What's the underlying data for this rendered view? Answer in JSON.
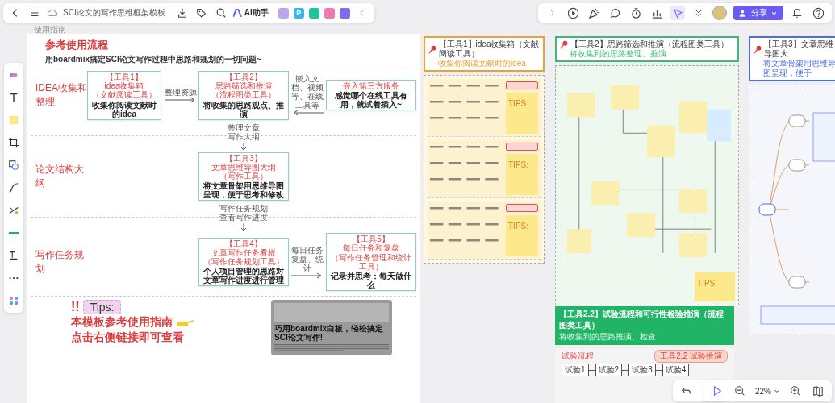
{
  "toolbar": {
    "title": "SCI论文的写作思维框架模板",
    "ai_button": "AI助手",
    "apps": [
      {
        "color": "#b9a7f0"
      },
      {
        "color": "#3bb6e8",
        "label": "P"
      },
      {
        "color": "#22c39a"
      },
      {
        "color": "#f07ab0"
      },
      {
        "color": "#7b6cf0"
      }
    ]
  },
  "board_label": "使用指南",
  "guide": {
    "title": "参考使用流程",
    "subtitle": "用boardmix搞定SCI论文写作过程中思路和规划的一切问题~",
    "stages": [
      "IDEA收集和整理",
      "论文结构大纲",
      "写作任务规划"
    ],
    "tools": [
      {
        "tag": "【工具1】",
        "name": "idea收集箱",
        "type": "（文献阅读工具）",
        "desc": "收集你阅读文献时的idea"
      },
      {
        "tag": "【工具2】",
        "name": "思路筛选和推演",
        "type": "（流程图类工具）",
        "desc": "将收集的思路观点、推演"
      },
      {
        "tag": "【工具3】",
        "name": "文章思维导图大纲",
        "type": "（写作工具）",
        "desc": "将文章骨架用思维导图呈现，便于思考和修改"
      },
      {
        "tag": "【工具4】",
        "name": "文章写作任务看板",
        "type": "（写作任务规划工具）",
        "desc": "个人项目管理的思路对文章写作进度进行管理"
      },
      {
        "tag": "【工具5】",
        "name": "每日任务和复盘",
        "type": "（写作任务管理和统计工具）",
        "desc": "记录并思考：每天做什么"
      }
    ],
    "embed": {
      "title": "嵌入第三方服务",
      "desc": "感觉哪个在线工具有用，就试着插入~"
    },
    "links": [
      {
        "kind": "right",
        "label": "整理资源"
      },
      {
        "kind": "left",
        "label": "嵌入文档、视频等、在线工具等"
      },
      {
        "kind": "down",
        "label": "整理文章写作大纲"
      },
      {
        "kind": "down",
        "label": "写作任务规划查看写作进度"
      },
      {
        "kind": "right",
        "label": "每日任务复盘、统计"
      }
    ],
    "tips": {
      "mark": "!!",
      "label": "Tips:",
      "lines": [
        "本模板参考使用指南",
        "点击右侧链接即可查看"
      ]
    },
    "article": {
      "title": "巧用boardmix白板，轻松搞定SCI论文写作!"
    }
  },
  "boards": [
    {
      "title": "【工具1】idea收集箱（文献阅读工具）",
      "subtitle": "收集你阅读文献时的idea",
      "color": "#f0a030",
      "tips": [
        "TIPS:",
        "TIPS:",
        "TIPS:"
      ]
    },
    {
      "title": "【工具2】思路筛选和推演（流程图类工具）",
      "subtitle": "将收集到的思路整理、推演",
      "color": "#3cb878",
      "tips": [
        "TIPS:"
      ]
    },
    {
      "title": "【工具3】文章思维导图大",
      "subtitle": "将文章骨架用思维导图呈现，便于",
      "color": "#4a6cf0"
    }
  ],
  "experiment_board": {
    "title": "【工具2.2】试验流程和可行性检验推演（流程图类工具）",
    "subtitle": "将收集到的思路推演、检查",
    "tag": "工具2.2 试验推演",
    "label": "试验流程",
    "steps": [
      "试验1",
      "试验2",
      "试验3",
      "试验4"
    ]
  },
  "share": {
    "label": "分享"
  },
  "zoom": {
    "value": "22%"
  }
}
